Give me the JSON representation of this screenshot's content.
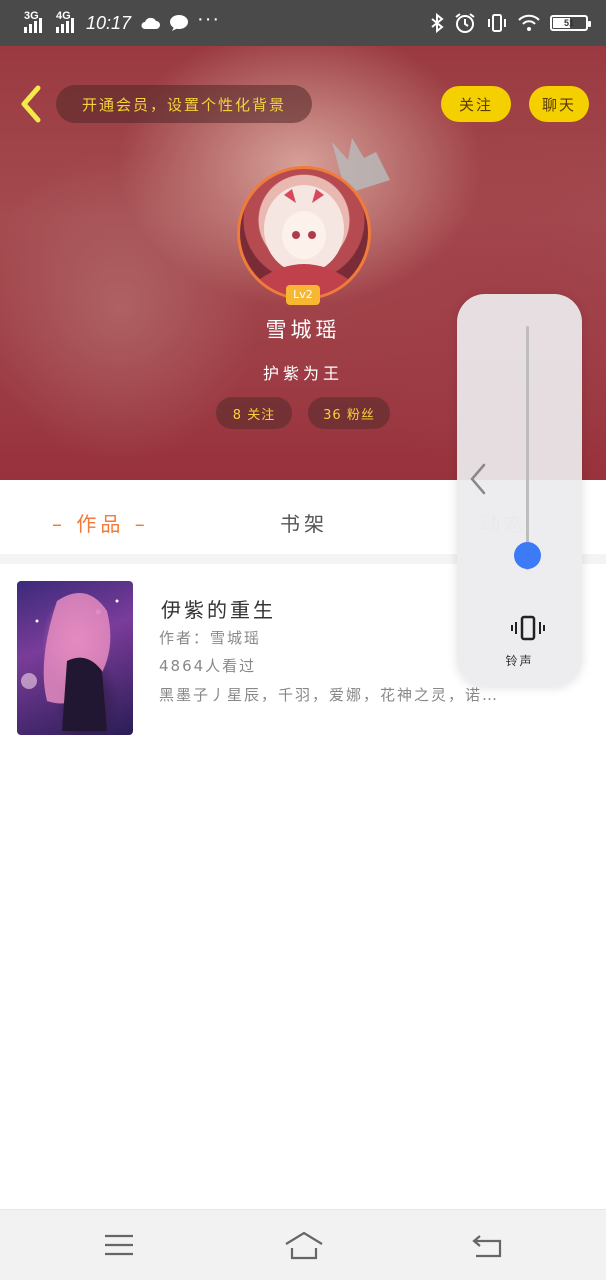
{
  "status_bar": {
    "network_1": "3G",
    "network_2": "4G",
    "time": "10:17",
    "battery": "51",
    "battery_level_pct": 51,
    "icons": [
      "cloud-icon",
      "chat-icon",
      "more-icon",
      "bluetooth-icon",
      "alarm-icon",
      "vibrate-icon",
      "wifi-icon",
      "battery-icon"
    ]
  },
  "header": {
    "vip_prompt": "开通会员，设置个性化背景",
    "follow_label": "关注",
    "chat_label": "聊天",
    "level": "Lv2",
    "nickname": "雪城瑶",
    "signature": "护紫为王",
    "following": "8 关注",
    "fans": "36 粉丝",
    "accent_color": "#f5d000"
  },
  "tabs": [
    {
      "label": "作品",
      "active": true
    },
    {
      "label": "书架",
      "active": false
    },
    {
      "label": "动态",
      "active": false
    }
  ],
  "books": [
    {
      "title": "伊紫的重生",
      "author": "作者：雪城瑶",
      "views": "4864人看过",
      "characters": "黑墨子丿星辰，千羽，爱娜，花神之灵，诺…"
    }
  ],
  "volume_panel": {
    "mode_label": "铃声",
    "level": 0.06,
    "accent_color": "#3d7af5"
  },
  "nav_bar": {
    "buttons": [
      "menu-icon",
      "home-icon",
      "back-icon"
    ]
  }
}
